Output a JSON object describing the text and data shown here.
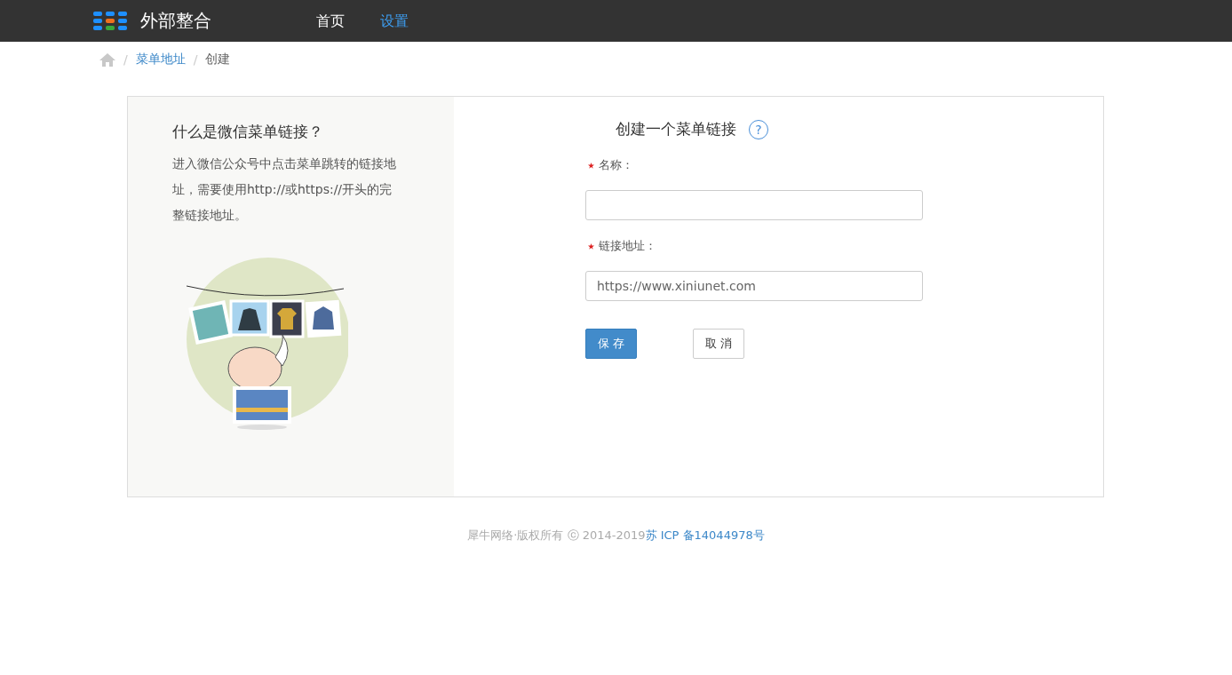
{
  "header": {
    "logo_text": "外部整合",
    "nav": [
      {
        "label": "首页",
        "selected": false
      },
      {
        "label": "设置",
        "selected": true
      }
    ]
  },
  "breadcrumb": [
    {
      "separator": "/",
      "label": "菜单地址",
      "kind": "link"
    },
    {
      "separator": "/",
      "label": "创建",
      "kind": "current"
    }
  ],
  "info": {
    "title": "什么是微信菜单链接？",
    "text": "进入微信公众号中点击菜单跳转的链接地址，需要使用http://或https://开头的完整链接地址。"
  },
  "form": {
    "title": "创建一个菜单链接",
    "help_icon": "?",
    "fields": [
      {
        "label": "名称：",
        "required": true
      },
      {
        "label": "链接地址：",
        "required": true,
        "placeholder": "https://www.xiniunet.com"
      }
    ],
    "buttons": [
      {
        "label": "保 存",
        "kind": "primary"
      },
      {
        "label": "取 消",
        "kind": "default"
      }
    ]
  },
  "footer": {
    "copyright": "犀牛网络·版权所有 ⓒ 2014-2019",
    "icp": "苏 ICP 备14044978号"
  }
}
